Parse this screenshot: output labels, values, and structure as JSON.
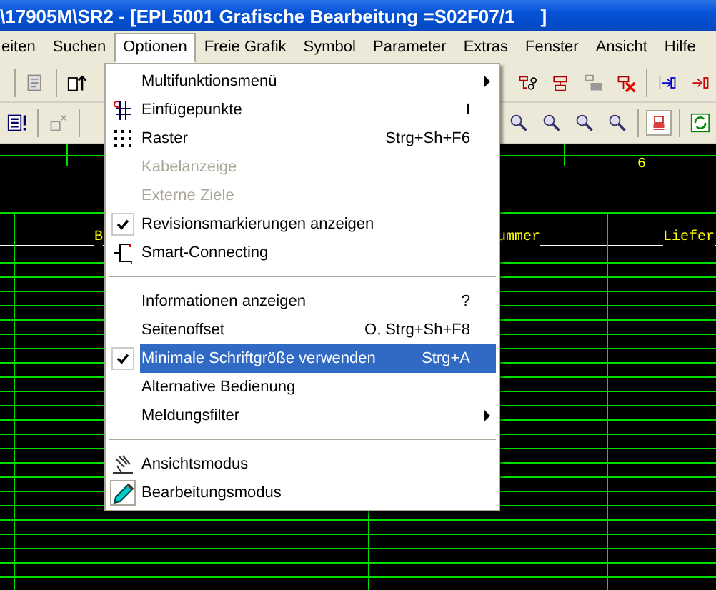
{
  "window": {
    "title": "\\17905M\\SR2 - [EPL5001 Grafische Bearbeitung =S02F07/1     ]"
  },
  "menubar": [
    {
      "label": "eiten",
      "selected": false
    },
    {
      "label": "Suchen",
      "selected": false
    },
    {
      "label": "Optionen",
      "selected": true
    },
    {
      "label": "Freie Grafik",
      "selected": false
    },
    {
      "label": "Symbol",
      "selected": false
    },
    {
      "label": "Parameter",
      "selected": false
    },
    {
      "label": "Extras",
      "selected": false
    },
    {
      "label": "Fenster",
      "selected": false
    },
    {
      "label": "Ansicht",
      "selected": false
    },
    {
      "label": "Hilfe",
      "selected": false
    }
  ],
  "menu": {
    "items": [
      {
        "kind": "item",
        "label": "Multifunktionsmenü",
        "checked": false,
        "disabled": false,
        "selected": false,
        "submenu": true
      },
      {
        "kind": "item",
        "label": "Einfügepunkte",
        "shortcut": "I",
        "checked": false,
        "disabled": false,
        "selected": false,
        "submenu": false
      },
      {
        "kind": "item",
        "label": "Raster",
        "shortcut": "Strg+Sh+F6",
        "checked": false,
        "disabled": false,
        "selected": false,
        "submenu": false
      },
      {
        "kind": "item",
        "label": "Kabelanzeige",
        "checked": false,
        "disabled": true,
        "selected": false,
        "submenu": false
      },
      {
        "kind": "item",
        "label": "Externe Ziele",
        "checked": false,
        "disabled": true,
        "selected": false,
        "submenu": false
      },
      {
        "kind": "item",
        "label": "Revisionsmarkierungen anzeigen",
        "checked": true,
        "disabled": false,
        "selected": false,
        "submenu": false
      },
      {
        "kind": "item",
        "label": "Smart-Connecting",
        "checked": false,
        "disabled": false,
        "selected": false,
        "submenu": false
      },
      {
        "kind": "separator"
      },
      {
        "kind": "item",
        "label": "Informationen anzeigen",
        "shortcut": "?",
        "checked": false,
        "disabled": false,
        "selected": false,
        "submenu": false
      },
      {
        "kind": "item",
        "label": "Seitenoffset",
        "shortcut": "O, Strg+Sh+F8",
        "checked": false,
        "disabled": false,
        "selected": false,
        "submenu": false
      },
      {
        "kind": "item",
        "label": "Minimale Schriftgröße verwenden",
        "shortcut": "Strg+A",
        "checked": true,
        "disabled": false,
        "selected": true,
        "submenu": false
      },
      {
        "kind": "item",
        "label": "Alternative Bedienung",
        "checked": false,
        "disabled": false,
        "selected": false,
        "submenu": false
      },
      {
        "kind": "item",
        "label": "Meldungsfilter",
        "checked": false,
        "disabled": false,
        "selected": false,
        "submenu": true
      },
      {
        "kind": "separator"
      },
      {
        "kind": "item",
        "label": "Ansichtsmodus",
        "checked": false,
        "disabled": false,
        "selected": false,
        "submenu": false
      },
      {
        "kind": "item",
        "label": "Bearbeitungsmodus",
        "checked": true,
        "disabled": false,
        "selected": false,
        "submenu": false
      }
    ]
  },
  "canvas": {
    "ruler_label": "6",
    "column_labels": [
      "B",
      "ummer",
      "Liefer"
    ]
  }
}
